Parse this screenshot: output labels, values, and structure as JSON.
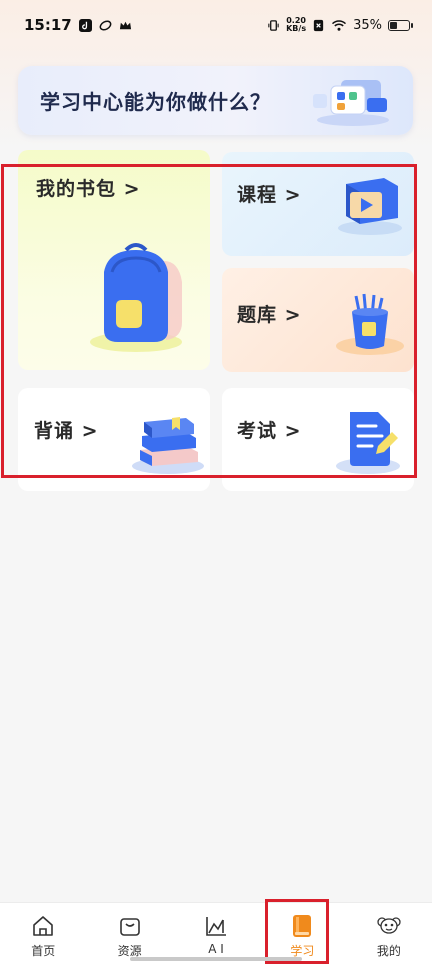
{
  "status_bar": {
    "time": "15:17",
    "net_speed_value": "0.20",
    "net_speed_unit": "KB/s",
    "battery_percent": "35%",
    "battery_level": 0.35
  },
  "banner": {
    "title": "学习中心能为你做什么？"
  },
  "cards": {
    "bag": "我的书包 >",
    "course": "课程 >",
    "bank": "题库 >",
    "recite": "背诵 >",
    "exam": "考试 >"
  },
  "nav": {
    "items": [
      {
        "label": "首页",
        "icon": "home-icon"
      },
      {
        "label": "资源",
        "icon": "bag-icon"
      },
      {
        "label": "A I",
        "icon": "chart-icon"
      },
      {
        "label": "学习",
        "icon": "book-icon"
      },
      {
        "label": "我的",
        "icon": "monkey-avatar-icon"
      }
    ],
    "active_index": 3,
    "active_color": "#f08a1c"
  },
  "colors": {
    "highlight": "#d9202c",
    "accent_blue": "#3a6ef0"
  }
}
